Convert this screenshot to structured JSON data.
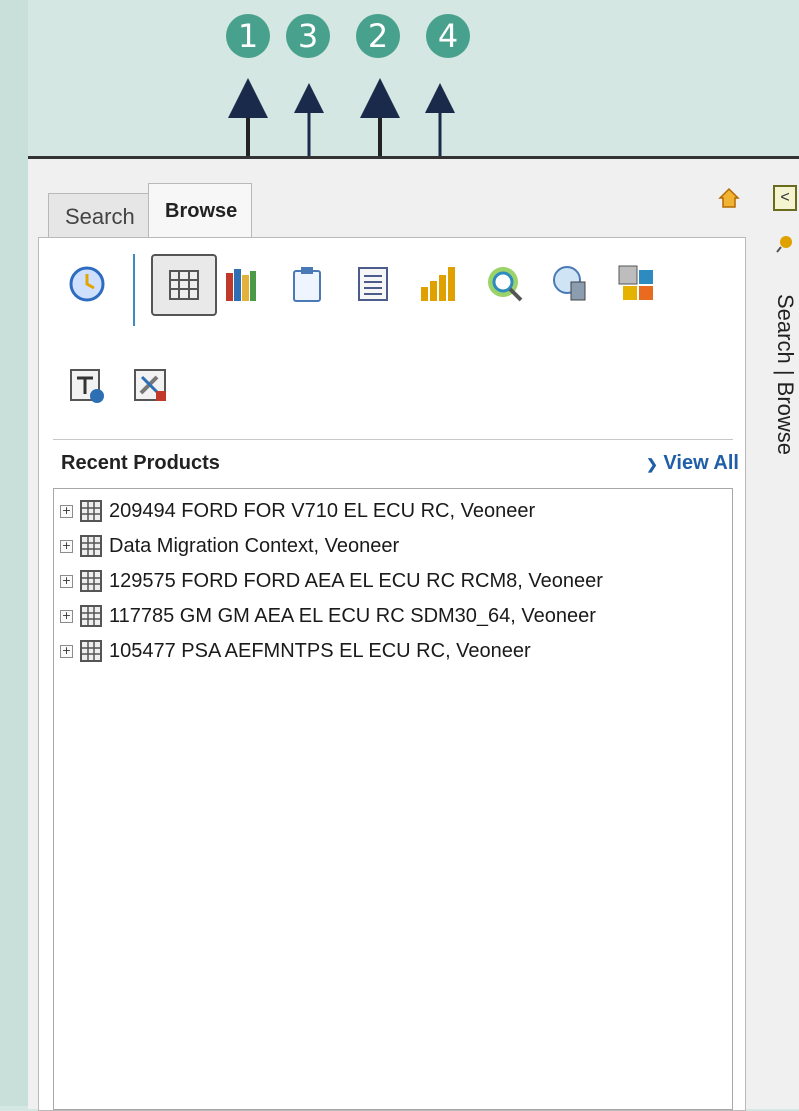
{
  "callouts": [
    "1",
    "3",
    "2",
    "4"
  ],
  "tabs": {
    "search": "Search",
    "browse": "Browse"
  },
  "toolbar_icons": [
    "history-clock-icon",
    "product-grid-icon",
    "library-books-icon",
    "clipboard-icon",
    "form-document-icon",
    "bar-chart-icon",
    "target-search-icon",
    "globe-building-icon",
    "color-blocks-icon",
    "properties-icon",
    "tools-icon"
  ],
  "recent": {
    "title": "Recent Products",
    "view_all": "View All"
  },
  "products": [
    "209494 FORD FOR V710 EL ECU RC, Veoneer",
    "Data Migration Context, Veoneer",
    "129575 FORD FORD AEA EL ECU RC RCM8, Veoneer",
    "117785 GM GM AEA EL ECU RC SDM30_64, Veoneer",
    "105477 PSA AEFMNTPS EL ECU RC, Veoneer"
  ],
  "rail": {
    "vertical_label": "Search | Browse"
  },
  "colors": {
    "accent_teal": "#48a18c",
    "background": "#d4e7e2",
    "link_blue": "#1f5fa8"
  }
}
